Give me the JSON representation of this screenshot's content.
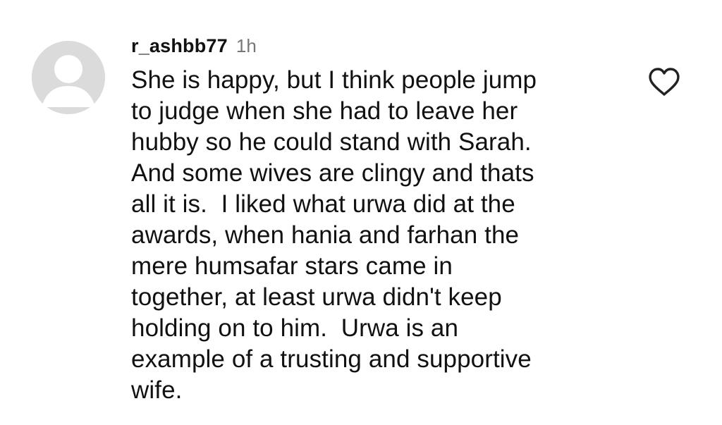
{
  "comment": {
    "username": "r_ashbb77",
    "timestamp": "1h",
    "avatar_icon": "default-user-avatar-icon",
    "like_icon": "heart-outline-icon",
    "text": "She is happy, but I think people jump\nto judge when she had to leave her\nhubby so he could stand with Sarah.\nAnd some wives are clingy and thats\nall it is.  I liked what urwa did at the\nawards, when hania and farhan the\nmere humsafar stars came in\ntogether, at least urwa didn't keep\nholding on to him.  Urwa is an\nexample of a trusting and supportive\nwife."
  },
  "colors": {
    "background": "#ffffff",
    "text": "#111111",
    "timestamp": "#777777",
    "avatar_bg": "#dbdbdb",
    "avatar_fg": "#ffffff",
    "icon": "#222222"
  }
}
